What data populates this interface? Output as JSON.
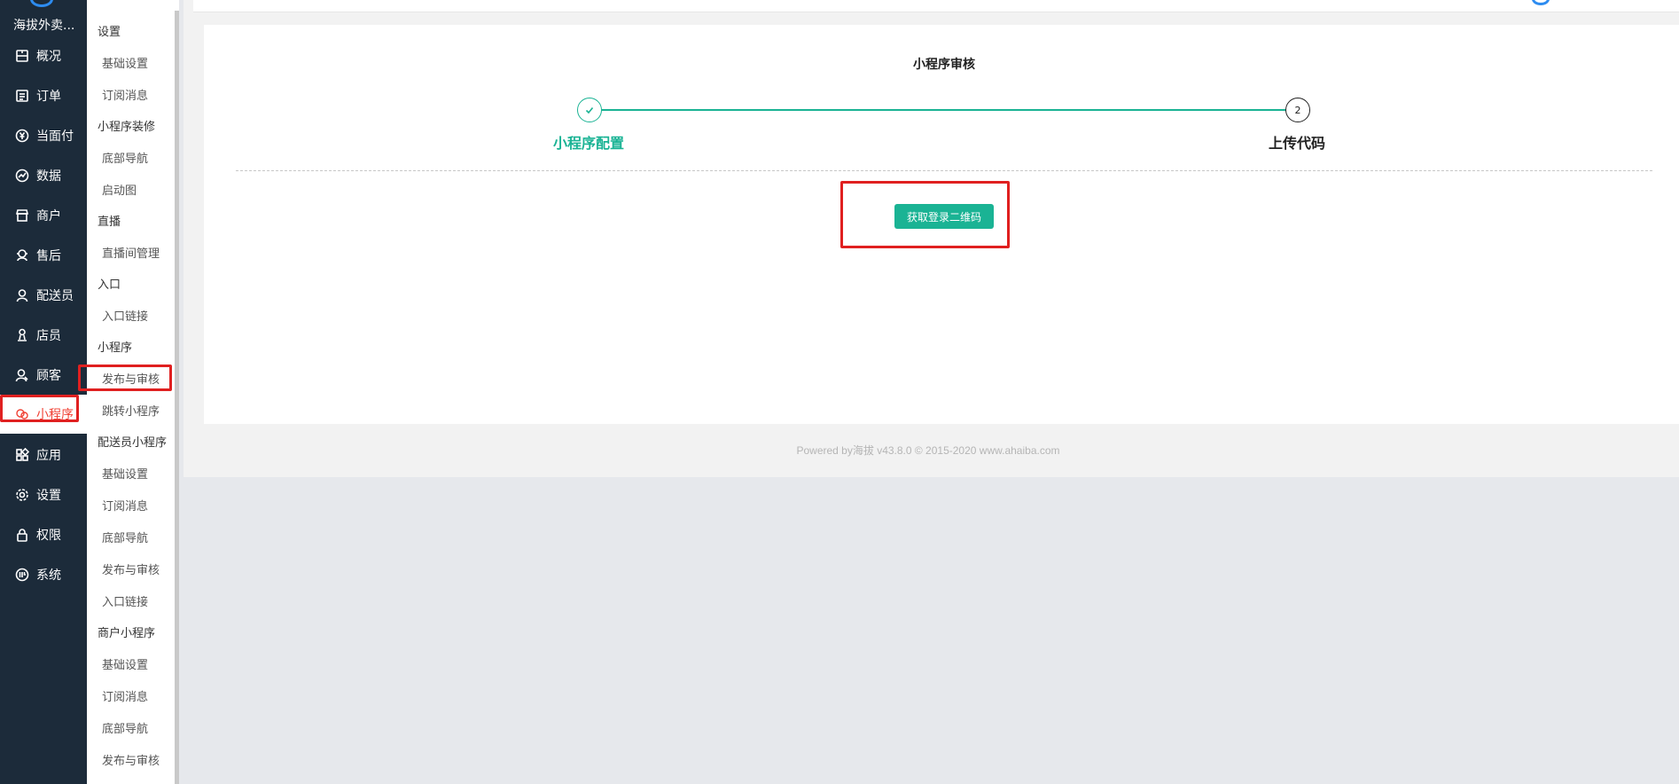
{
  "app": {
    "title": "海拔外卖..."
  },
  "nav": {
    "items": [
      {
        "label": "概况",
        "icon": "overview-icon"
      },
      {
        "label": "订单",
        "icon": "order-icon"
      },
      {
        "label": "当面付",
        "icon": "yen-icon"
      },
      {
        "label": "数据",
        "icon": "chart-icon"
      },
      {
        "label": "商户",
        "icon": "store-icon"
      },
      {
        "label": "售后",
        "icon": "aftersale-icon"
      },
      {
        "label": "配送员",
        "icon": "courier-icon"
      },
      {
        "label": "店员",
        "icon": "clerk-icon"
      },
      {
        "label": "顾客",
        "icon": "customer-icon"
      },
      {
        "label": "小程序",
        "icon": "miniprogram-icon",
        "active": true
      },
      {
        "label": "应用",
        "icon": "apps-icon"
      },
      {
        "label": "设置",
        "icon": "gear-icon"
      },
      {
        "label": "权限",
        "icon": "lock-icon"
      },
      {
        "label": "系统",
        "icon": "system-icon"
      }
    ],
    "accent": "#f04134"
  },
  "submenu": {
    "entries": [
      {
        "type": "group",
        "label": "设置"
      },
      {
        "type": "item",
        "label": "基础设置"
      },
      {
        "type": "item",
        "label": "订阅消息"
      },
      {
        "type": "group",
        "label": "小程序装修"
      },
      {
        "type": "item",
        "label": "底部导航"
      },
      {
        "type": "item",
        "label": "启动图"
      },
      {
        "type": "group",
        "label": "直播"
      },
      {
        "type": "item",
        "label": "直播间管理"
      },
      {
        "type": "group",
        "label": "入口"
      },
      {
        "type": "item",
        "label": "入口链接"
      },
      {
        "type": "group",
        "label": "小程序"
      },
      {
        "type": "item",
        "label": "发布与审核",
        "highlighted": true
      },
      {
        "type": "item",
        "label": "跳转小程序"
      },
      {
        "type": "group",
        "label": "配送员小程序"
      },
      {
        "type": "item",
        "label": "基础设置"
      },
      {
        "type": "item",
        "label": "订阅消息"
      },
      {
        "type": "item",
        "label": "底部导航"
      },
      {
        "type": "item",
        "label": "发布与审核"
      },
      {
        "type": "item",
        "label": "入口链接"
      },
      {
        "type": "group",
        "label": "商户小程序"
      },
      {
        "type": "item",
        "label": "基础设置"
      },
      {
        "type": "item",
        "label": "订阅消息"
      },
      {
        "type": "item",
        "label": "底部导航"
      },
      {
        "type": "item",
        "label": "发布与审核"
      }
    ]
  },
  "main": {
    "title": "小程序审核",
    "steps": [
      {
        "number": "",
        "label": "小程序配置",
        "status": "done"
      },
      {
        "number": "2",
        "label": "上传代码",
        "status": "pending"
      }
    ],
    "qr_button_label": "获取登录二维码",
    "accent": "#1ab394"
  },
  "footer": {
    "text": "Powered by海拔 v43.8.0 © 2015-2020 www.ahaiba.com"
  },
  "annotation_color": "#e02020"
}
